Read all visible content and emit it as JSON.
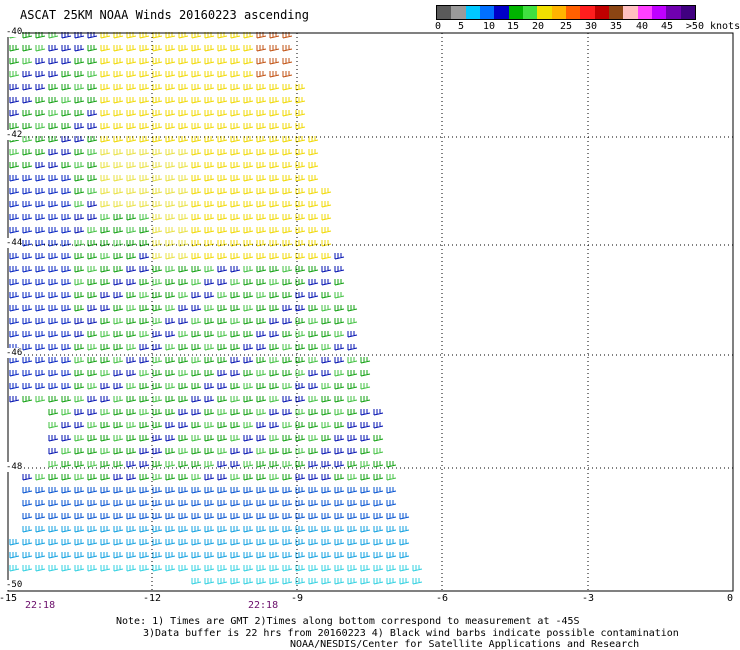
{
  "title": "ASCAT 25KM NOAA Winds 20160223 ascending",
  "legend": {
    "ticks": [
      "0",
      "5",
      "10",
      "15",
      "20",
      "25",
      "30",
      "35",
      "40",
      "45",
      ">50 knots"
    ],
    "colors": [
      "#5a5a5a",
      "#9a9a9a",
      "#00c8ff",
      "#0070ff",
      "#0000c8",
      "#00b400",
      "#40e040",
      "#f0e000",
      "#ffb400",
      "#ff6000",
      "#ff1e1e",
      "#c00000",
      "#8b4513",
      "#ffc0c0",
      "#ff40ff",
      "#c000ff",
      "#7000b0",
      "#400080"
    ]
  },
  "map": {
    "lon_labels": [
      "-15",
      "-12",
      "-9",
      "-6",
      "-3",
      "0"
    ],
    "lat_labels": [
      "-40",
      "-42",
      "-44",
      "-46",
      "-48",
      "-50"
    ],
    "time_labels": [
      "22:18",
      "22:18"
    ]
  },
  "notes": {
    "line1": "Note: 1) Times are GMT 2)Times along bottom correspond to measurement at -45S",
    "line2": "3)Data buffer is 22 hrs from 20160223 4) Black wind barbs indicate possible contamination",
    "line3": "NOAA/NESDIS/Center for Satellite Applications and Research"
  }
}
